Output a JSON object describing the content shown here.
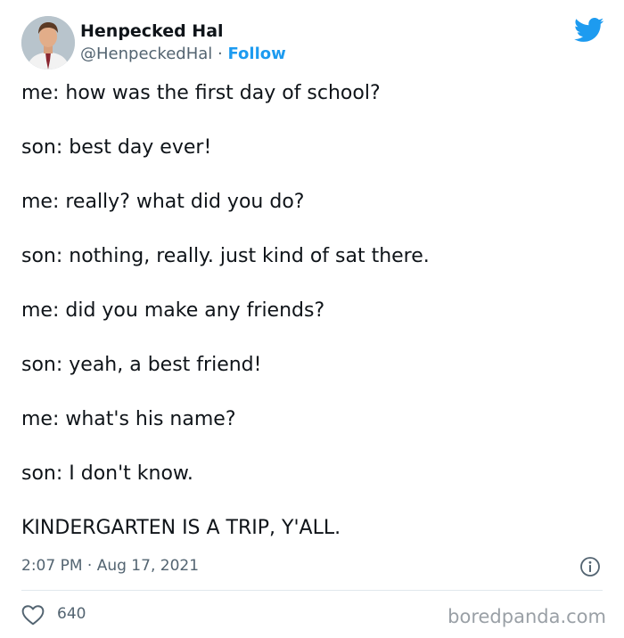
{
  "author": {
    "display_name": "Henpecked Hal",
    "handle": "@HenpeckedHal",
    "separator": "·",
    "follow_label": "Follow"
  },
  "tweet": {
    "lines": [
      "me: how was the first day of school?",
      "son: best day ever!",
      "me: really? what did you do?",
      "son: nothing, really. just kind of sat there.",
      "me: did you make any friends?",
      "son: yeah, a best friend!",
      "me: what's his name?",
      "son: I don't know.",
      "KINDERGARTEN IS A TRIP, Y'ALL."
    ],
    "timestamp": "2:07 PM · Aug 17, 2021",
    "like_count": "640"
  },
  "watermark": "boredpanda.com",
  "icons": {
    "brand": "twitter-bird-icon",
    "info": "info-icon",
    "like": "heart-icon"
  },
  "colors": {
    "brand_blue": "#1d9bf0",
    "text": "#0f1419",
    "secondary_text": "#536471",
    "watermark": "#9aa0a6"
  }
}
